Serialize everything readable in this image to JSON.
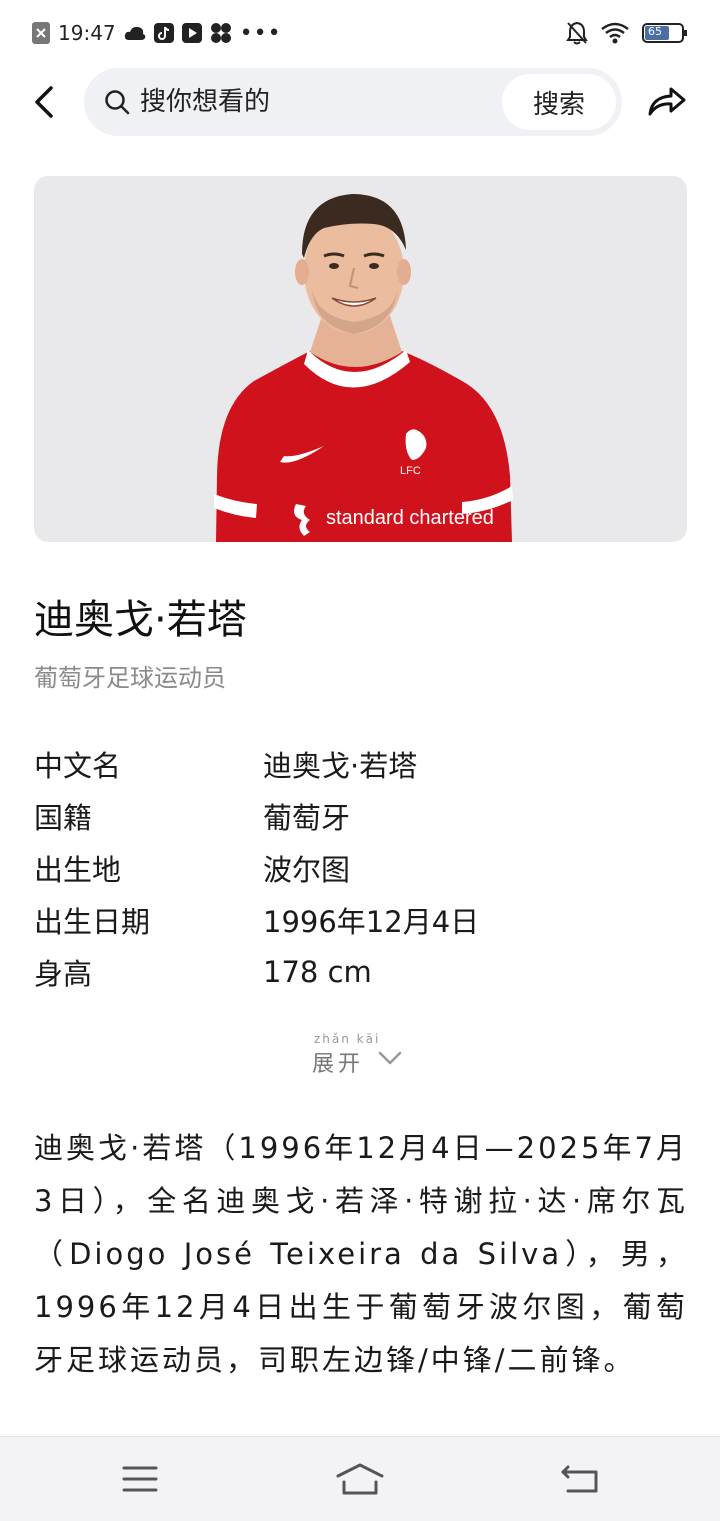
{
  "status_bar": {
    "time": "19:47",
    "battery": "65"
  },
  "search": {
    "placeholder": "搜你想看的",
    "button_label": "搜索"
  },
  "player": {
    "name": "迪奥戈·若塔",
    "description": "葡萄牙足球运动员",
    "jersey_sponsor": "standard chartered",
    "crest_text": "LFC"
  },
  "info": [
    {
      "key": "中文名",
      "value": "迪奥戈·若塔"
    },
    {
      "key": "国籍",
      "value": "葡萄牙"
    },
    {
      "key": "出生地",
      "value": "波尔图"
    },
    {
      "key": "出生日期",
      "value": "1996年12月4日"
    },
    {
      "key": "身高",
      "value": "178 cm"
    }
  ],
  "expand": {
    "pinyin": "zhǎn kāi",
    "label": "展开"
  },
  "summary": "迪奥戈·若塔（1996年12月4日—2025年7月3日），全名迪奥戈·若泽·特谢拉·达·席尔瓦（Diogo José Teixeira da Silva），男，1996年12月4日出生于葡萄牙波尔图，葡萄牙足球运动员，司职左边锋/中锋/二前锋。",
  "colors": {
    "jersey_red": "#d0121d",
    "search_bg": "#f0f1f5",
    "hero_bg": "#e9e9ec"
  },
  "icons": [
    "back-arrow-icon",
    "search-icon",
    "share-icon",
    "menu-icon",
    "home-icon",
    "return-icon"
  ]
}
